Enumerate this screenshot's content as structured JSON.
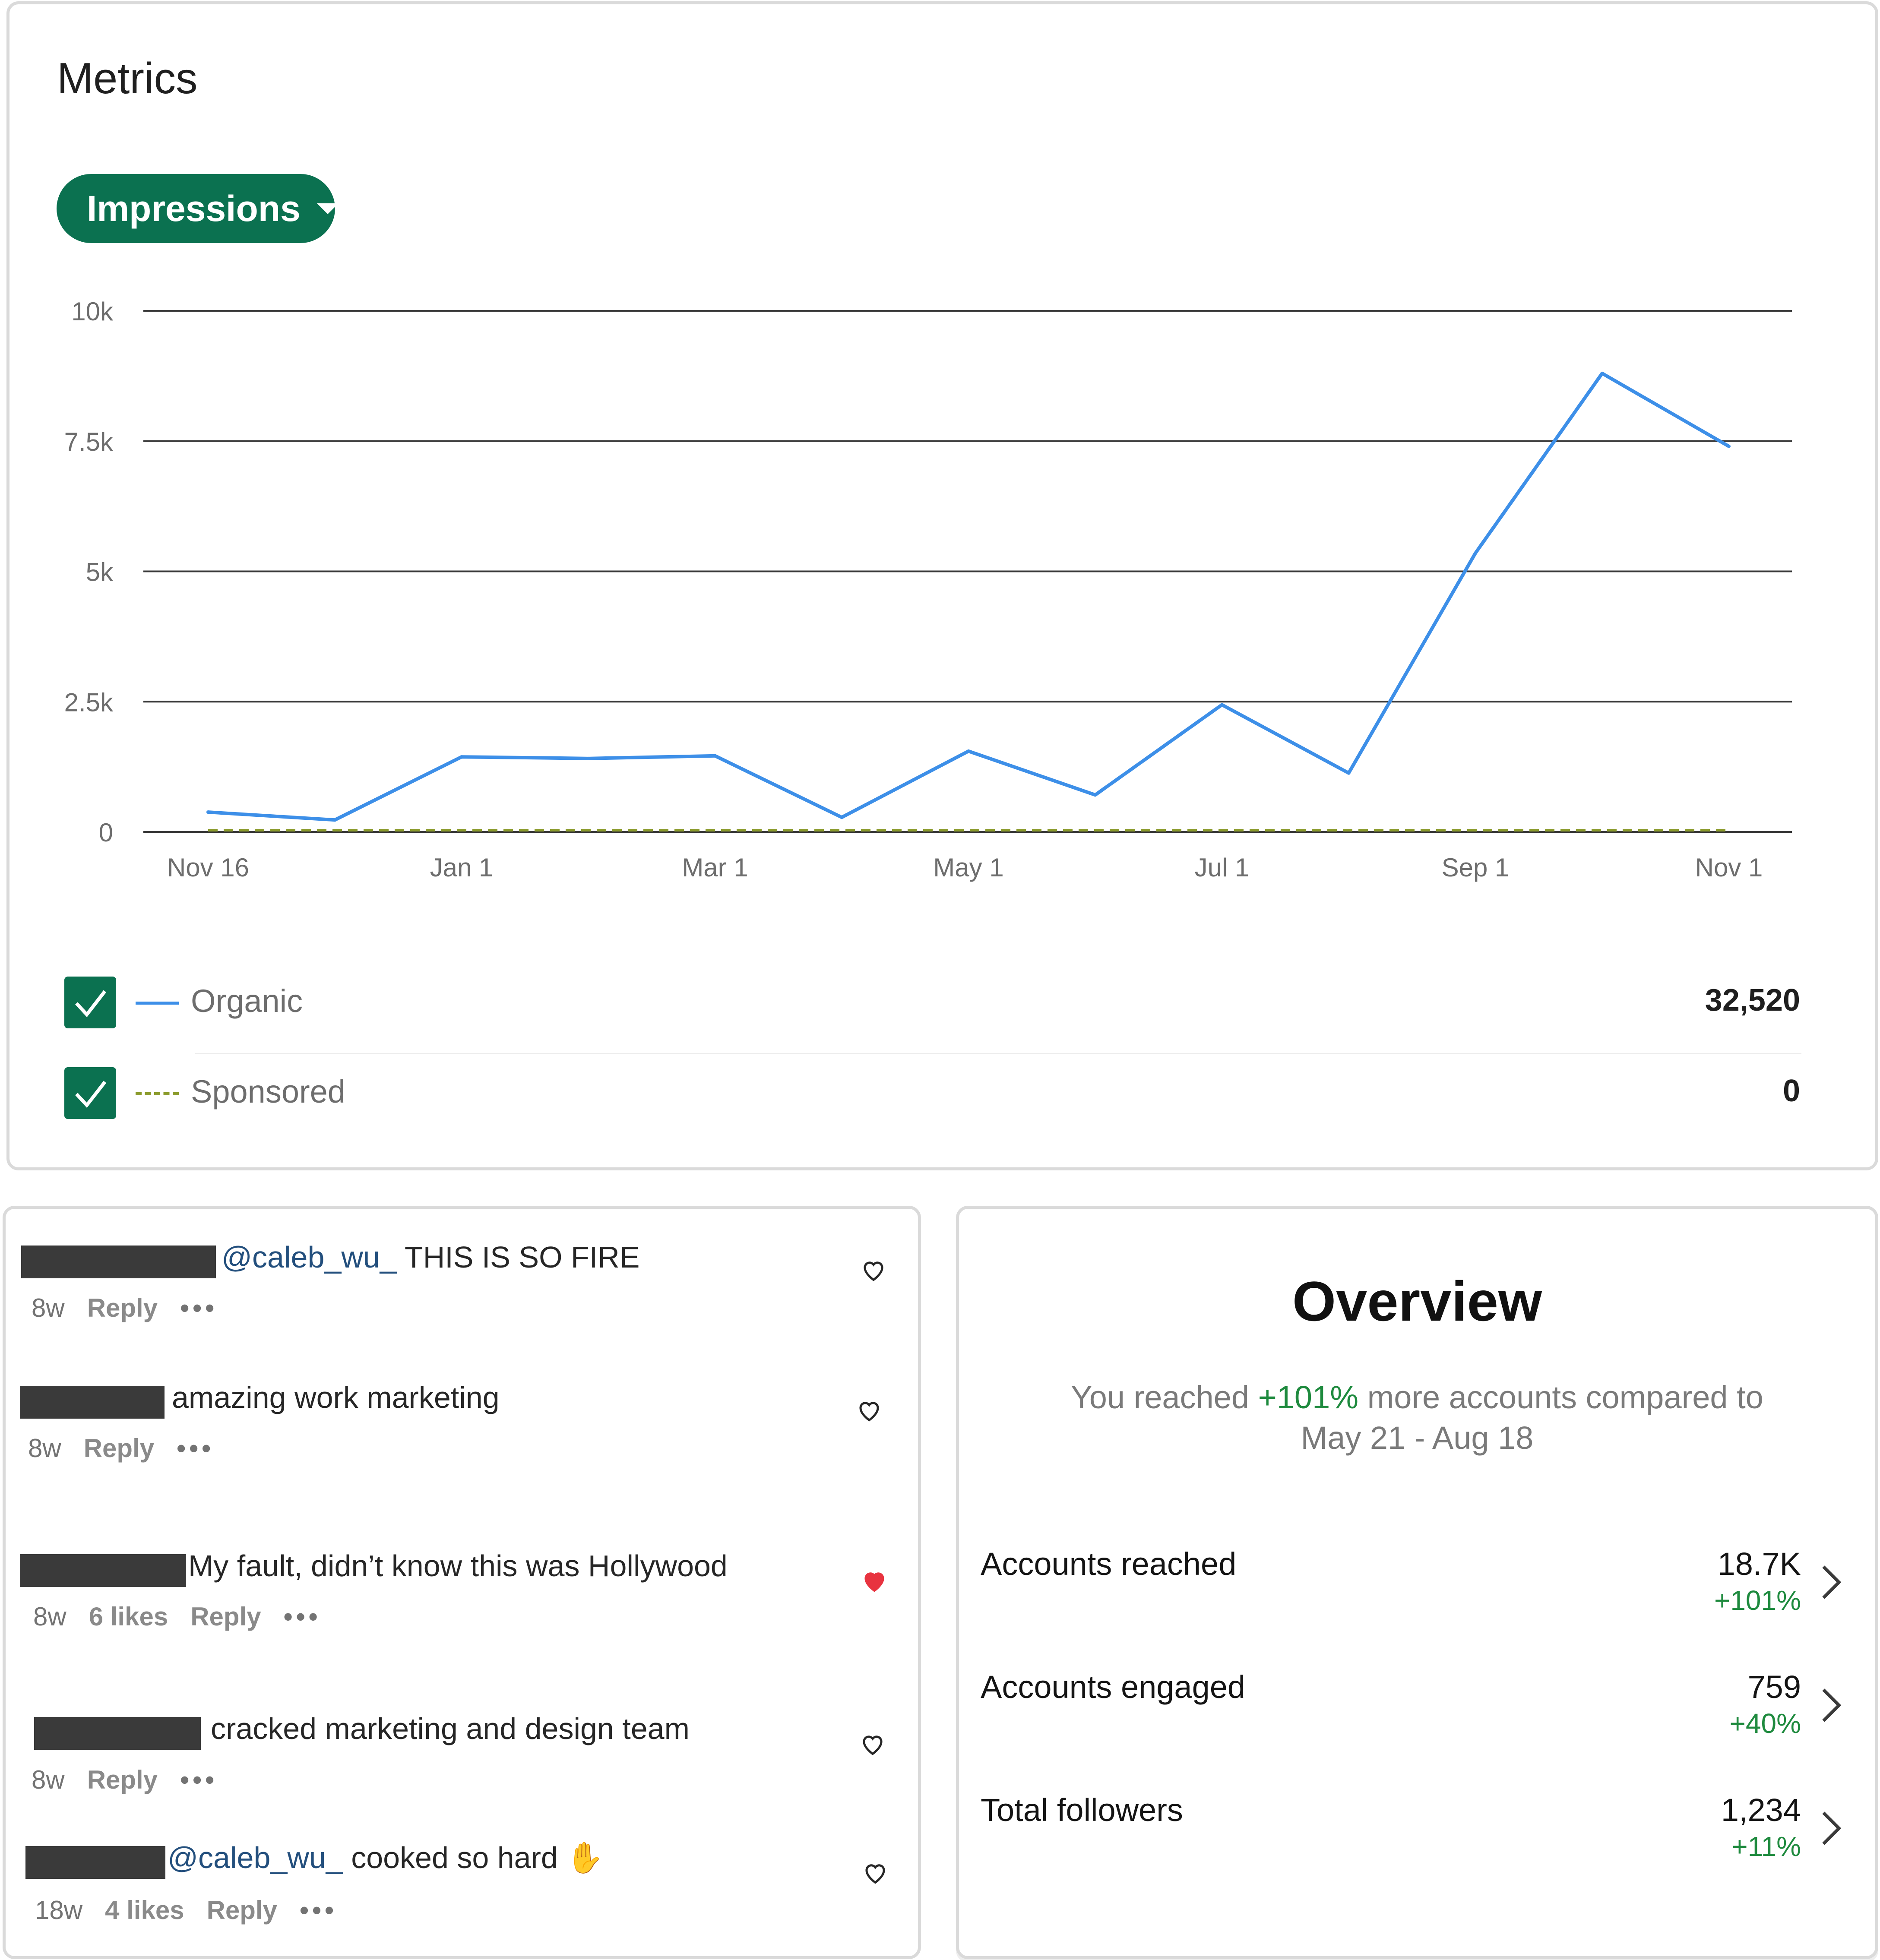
{
  "metrics": {
    "title": "Metrics",
    "dropdown_label": "Impressions",
    "legend": [
      {
        "name": "Organic",
        "total": "32,520",
        "checked": true,
        "color": "#3d8fe8",
        "style": "solid"
      },
      {
        "name": "Sponsored",
        "total": "0",
        "checked": true,
        "color": "#8b9b2c",
        "style": "dashed"
      }
    ]
  },
  "chart_data": {
    "type": "line",
    "x": [
      "Nov 16",
      "Dec 1",
      "Jan 1",
      "Feb 1",
      "Mar 1",
      "Apr 1",
      "May 1",
      "Jun 1",
      "Jul 1",
      "Aug 1",
      "Sep 1",
      "Oct 1",
      "Nov 1"
    ],
    "x_tick_labels": [
      "Nov 16",
      "Jan 1",
      "Mar 1",
      "May 1",
      "Jul 1",
      "Sep 1",
      "Nov 1"
    ],
    "y_tick_labels": [
      "0",
      "2.5k",
      "5k",
      "7.5k",
      "10k"
    ],
    "ylim": [
      0,
      10000
    ],
    "grid": true,
    "series": [
      {
        "name": "Organic",
        "values": [
          380,
          230,
          1440,
          1410,
          1460,
          280,
          1550,
          710,
          2440,
          1130,
          5350,
          8800,
          7400
        ]
      },
      {
        "name": "Sponsored",
        "values": [
          0,
          0,
          0,
          0,
          0,
          0,
          0,
          0,
          0,
          0,
          0,
          0,
          0
        ]
      }
    ]
  },
  "comments": [
    {
      "mention": "@caleb_wu_",
      "text": " THIS IS SO FIRE",
      "age": "8w",
      "likes": "",
      "reply": "Reply",
      "liked": false
    },
    {
      "mention": "",
      "text": "amazing work marketing",
      "age": "8w",
      "likes": "",
      "reply": "Reply",
      "liked": false
    },
    {
      "mention": "",
      "text": "My fault, didn’t know this was Hollywood",
      "age": "8w",
      "likes": "6 likes",
      "reply": "Reply",
      "liked": true
    },
    {
      "mention": "",
      "text": "cracked marketing and design team",
      "age": "8w",
      "likes": "",
      "reply": "Reply",
      "liked": false
    },
    {
      "mention": "@caleb_wu_",
      "text": " cooked so hard ✋",
      "age": "18w",
      "likes": "4 likes",
      "reply": "Reply",
      "liked": false
    }
  ],
  "overview": {
    "title": "Overview",
    "subtitle_before": "You reached ",
    "subtitle_pct": "+101%",
    "subtitle_after": " more accounts compared to",
    "subtitle_range": "May 21 - Aug 18",
    "rows": [
      {
        "label": "Accounts reached",
        "value": "18.7K",
        "delta": "+101%"
      },
      {
        "label": "Accounts engaged",
        "value": "759",
        "delta": "+40%"
      },
      {
        "label": "Total followers",
        "value": "1,234",
        "delta": "+11%"
      }
    ]
  },
  "colors": {
    "brand_green": "#0b7150",
    "positive": "#1e8a3e",
    "heart_red": "#e8333f",
    "mention_blue": "#234f7d"
  }
}
